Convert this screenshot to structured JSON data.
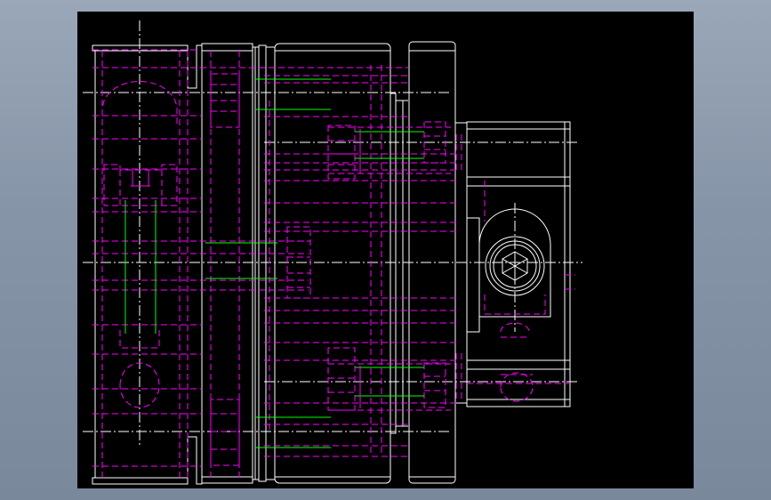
{
  "viewer": {
    "background_color": "#8a97aa",
    "canvas_color": "#000000"
  },
  "drawing": {
    "line_colors": {
      "outline": "#ffffff",
      "hidden": "#ff00ff",
      "center": "#ffffff",
      "thread": "#00ff00"
    }
  }
}
